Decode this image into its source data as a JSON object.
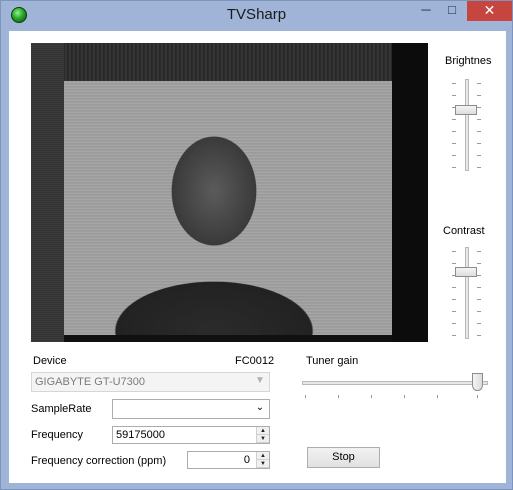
{
  "window": {
    "title": "TVSharp",
    "icon": "satellite-dish-icon",
    "controls": {
      "minimize": "─",
      "maximize": "□",
      "close": "✕"
    }
  },
  "brightness": {
    "label": "Brightnes",
    "level_fraction": 0.5
  },
  "contrast": {
    "label": "Contrast",
    "level_fraction": 0.5
  },
  "device": {
    "label": "Device",
    "chip": "FC0012",
    "selected": "GIGABYTE GT-U7300",
    "enabled": false
  },
  "tuner_gain": {
    "label": "Tuner gain",
    "level_fraction": 1.0
  },
  "sample_rate": {
    "label": "SampleRate",
    "selected": ""
  },
  "frequency": {
    "label": "Frequency",
    "value": "59175000"
  },
  "frequency_correction": {
    "label": "Frequency correction (ppm)",
    "value": "0"
  },
  "stop_button": {
    "label": "Stop"
  }
}
